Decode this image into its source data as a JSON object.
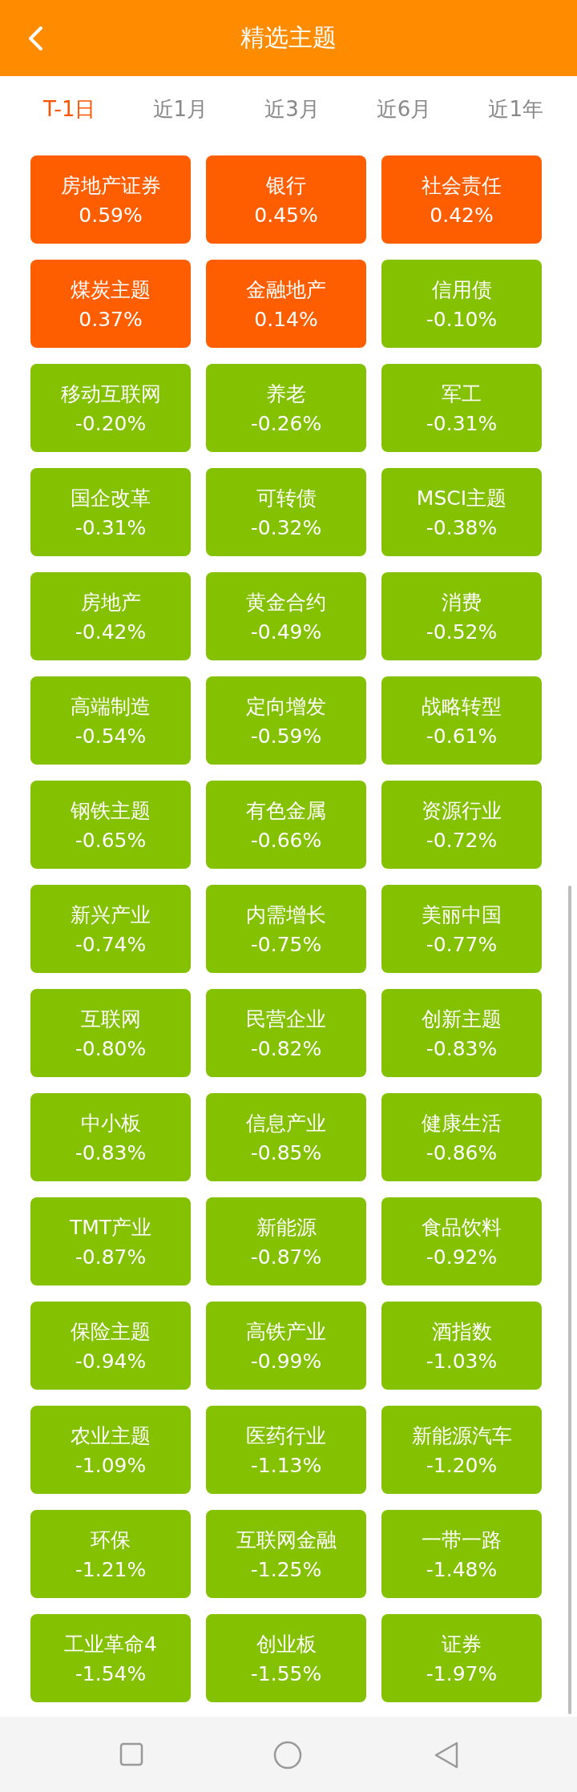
{
  "header": {
    "title": "精选主题"
  },
  "tabs": [
    {
      "label": "T-1日",
      "selected": true
    },
    {
      "label": "近1月",
      "selected": false
    },
    {
      "label": "近3月",
      "selected": false
    },
    {
      "label": "近6月",
      "selected": false
    },
    {
      "label": "近1年",
      "selected": false
    }
  ],
  "tiles": [
    {
      "name": "房地产证券",
      "change": "0.59%",
      "color": "#ff5e00"
    },
    {
      "name": "银行",
      "change": "0.45%",
      "color": "#ff5e00"
    },
    {
      "name": "社会责任",
      "change": "0.42%",
      "color": "#ff5e00"
    },
    {
      "name": "煤炭主题",
      "change": "0.37%",
      "color": "#ff5e00"
    },
    {
      "name": "金融地产",
      "change": "0.14%",
      "color": "#ff5e00"
    },
    {
      "name": "信用债",
      "change": "-0.10%",
      "color": "#84c100"
    },
    {
      "name": "移动互联网",
      "change": "-0.20%",
      "color": "#84c100"
    },
    {
      "name": "养老",
      "change": "-0.26%",
      "color": "#84c100"
    },
    {
      "name": "军工",
      "change": "-0.31%",
      "color": "#84c100"
    },
    {
      "name": "国企改革",
      "change": "-0.31%",
      "color": "#84c100"
    },
    {
      "name": "可转债",
      "change": "-0.32%",
      "color": "#84c100"
    },
    {
      "name": "MSCI主题",
      "change": "-0.38%",
      "color": "#84c100"
    },
    {
      "name": "房地产",
      "change": "-0.42%",
      "color": "#84c100"
    },
    {
      "name": "黄金合约",
      "change": "-0.49%",
      "color": "#84c100"
    },
    {
      "name": "消费",
      "change": "-0.52%",
      "color": "#84c100"
    },
    {
      "name": "高端制造",
      "change": "-0.54%",
      "color": "#84c100"
    },
    {
      "name": "定向增发",
      "change": "-0.59%",
      "color": "#84c100"
    },
    {
      "name": "战略转型",
      "change": "-0.61%",
      "color": "#84c100"
    },
    {
      "name": "钢铁主题",
      "change": "-0.65%",
      "color": "#84c100"
    },
    {
      "name": "有色金属",
      "change": "-0.66%",
      "color": "#84c100"
    },
    {
      "name": "资源行业",
      "change": "-0.72%",
      "color": "#84c100"
    },
    {
      "name": "新兴产业",
      "change": "-0.74%",
      "color": "#84c100"
    },
    {
      "name": "内需增长",
      "change": "-0.75%",
      "color": "#84c100"
    },
    {
      "name": "美丽中国",
      "change": "-0.77%",
      "color": "#84c100"
    },
    {
      "name": "互联网",
      "change": "-0.80%",
      "color": "#84c100"
    },
    {
      "name": "民营企业",
      "change": "-0.82%",
      "color": "#84c100"
    },
    {
      "name": "创新主题",
      "change": "-0.83%",
      "color": "#84c100"
    },
    {
      "name": "中小板",
      "change": "-0.83%",
      "color": "#84c100"
    },
    {
      "name": "信息产业",
      "change": "-0.85%",
      "color": "#84c100"
    },
    {
      "name": "健康生活",
      "change": "-0.86%",
      "color": "#84c100"
    },
    {
      "name": "TMT产业",
      "change": "-0.87%",
      "color": "#84c100"
    },
    {
      "name": "新能源",
      "change": "-0.87%",
      "color": "#84c100"
    },
    {
      "name": "食品饮料",
      "change": "-0.92%",
      "color": "#84c100"
    },
    {
      "name": "保险主题",
      "change": "-0.94%",
      "color": "#84c100"
    },
    {
      "name": "高铁产业",
      "change": "-0.99%",
      "color": "#84c100"
    },
    {
      "name": "酒指数",
      "change": "-1.03%",
      "color": "#84c100"
    },
    {
      "name": "农业主题",
      "change": "-1.09%",
      "color": "#84c100"
    },
    {
      "name": "医药行业",
      "change": "-1.13%",
      "color": "#84c100"
    },
    {
      "name": "新能源汽车",
      "change": "-1.20%",
      "color": "#84c100"
    },
    {
      "name": "环保",
      "change": "-1.21%",
      "color": "#84c100"
    },
    {
      "name": "互联网金融",
      "change": "-1.25%",
      "color": "#84c100"
    },
    {
      "name": "一带一路",
      "change": "-1.48%",
      "color": "#84c100"
    },
    {
      "name": "工业革命4",
      "change": "-1.54%",
      "color": "#84c100"
    },
    {
      "name": "创业板",
      "change": "-1.55%",
      "color": "#84c100"
    },
    {
      "name": "证券",
      "change": "-1.97%",
      "color": "#84c100"
    }
  ]
}
